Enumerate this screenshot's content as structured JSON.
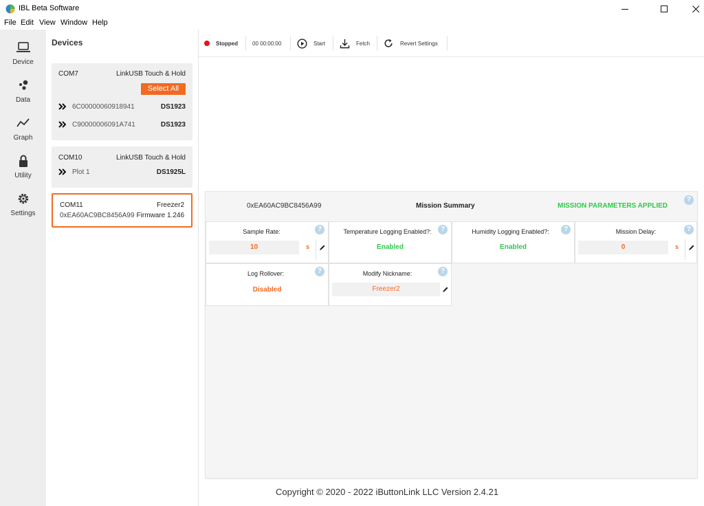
{
  "window": {
    "title": "IBL Beta Software"
  },
  "menu": [
    "File",
    "Edit",
    "View",
    "Window",
    "Help"
  ],
  "rail": [
    {
      "label": "Device",
      "icon": "laptop-icon"
    },
    {
      "label": "Data",
      "icon": "data-icon"
    },
    {
      "label": "Graph",
      "icon": "graph-icon"
    },
    {
      "label": "Utility",
      "icon": "lock-icon"
    },
    {
      "label": "Settings",
      "icon": "gear-icon"
    }
  ],
  "devices": {
    "title": "Devices",
    "cards": [
      {
        "port": "COM7",
        "adapter": "LinkUSB Touch & Hold",
        "select_all": "Select All",
        "items": [
          {
            "serial": "6C00000060918941",
            "model": "DS1923"
          },
          {
            "serial": "C90000006091A741",
            "model": "DS1923"
          }
        ]
      },
      {
        "port": "COM10",
        "adapter": "LinkUSB Touch & Hold",
        "items": [
          {
            "serial": "Plot 1",
            "model": "DS1925L"
          }
        ]
      },
      {
        "port": "COM11",
        "nickname": "Freezer2",
        "address": "0xEA60AC9BC8456A99",
        "firmware": "Firmware 1.246"
      }
    ]
  },
  "toolbar": {
    "status": "Stopped",
    "timer": "00 00:00:00",
    "start": "Start",
    "fetch": "Fetch",
    "revert": "Revert Settings"
  },
  "mission": {
    "id": "0xEA60AC9BC8456A99",
    "title": "Mission Summary",
    "status": "MISSION PARAMETERS APPLIED",
    "help": "?",
    "sample_rate": {
      "label": "Sample Rate:",
      "value": "10",
      "unit": "s"
    },
    "temp_logging": {
      "label": "Temperature Logging Enabled?:",
      "value": "Enabled"
    },
    "humidity_logging": {
      "label": "Humidity Logging Enabled?:",
      "value": "Enabled"
    },
    "mission_delay": {
      "label": "Mission Delay:",
      "value": "0",
      "unit": "s"
    },
    "log_rollover": {
      "label": "Log Rollover:",
      "value": "Disabled"
    },
    "nickname": {
      "label": "Modify Nickname:",
      "value": "Freezer2"
    }
  },
  "footer": "Copyright © 2020 - 2022 iButtonLink LLC Version 2.4.21",
  "colors": {
    "accent": "#f26a21",
    "success": "#34c74f",
    "stopped": "#e8141c",
    "help": "#b9d6ea"
  }
}
